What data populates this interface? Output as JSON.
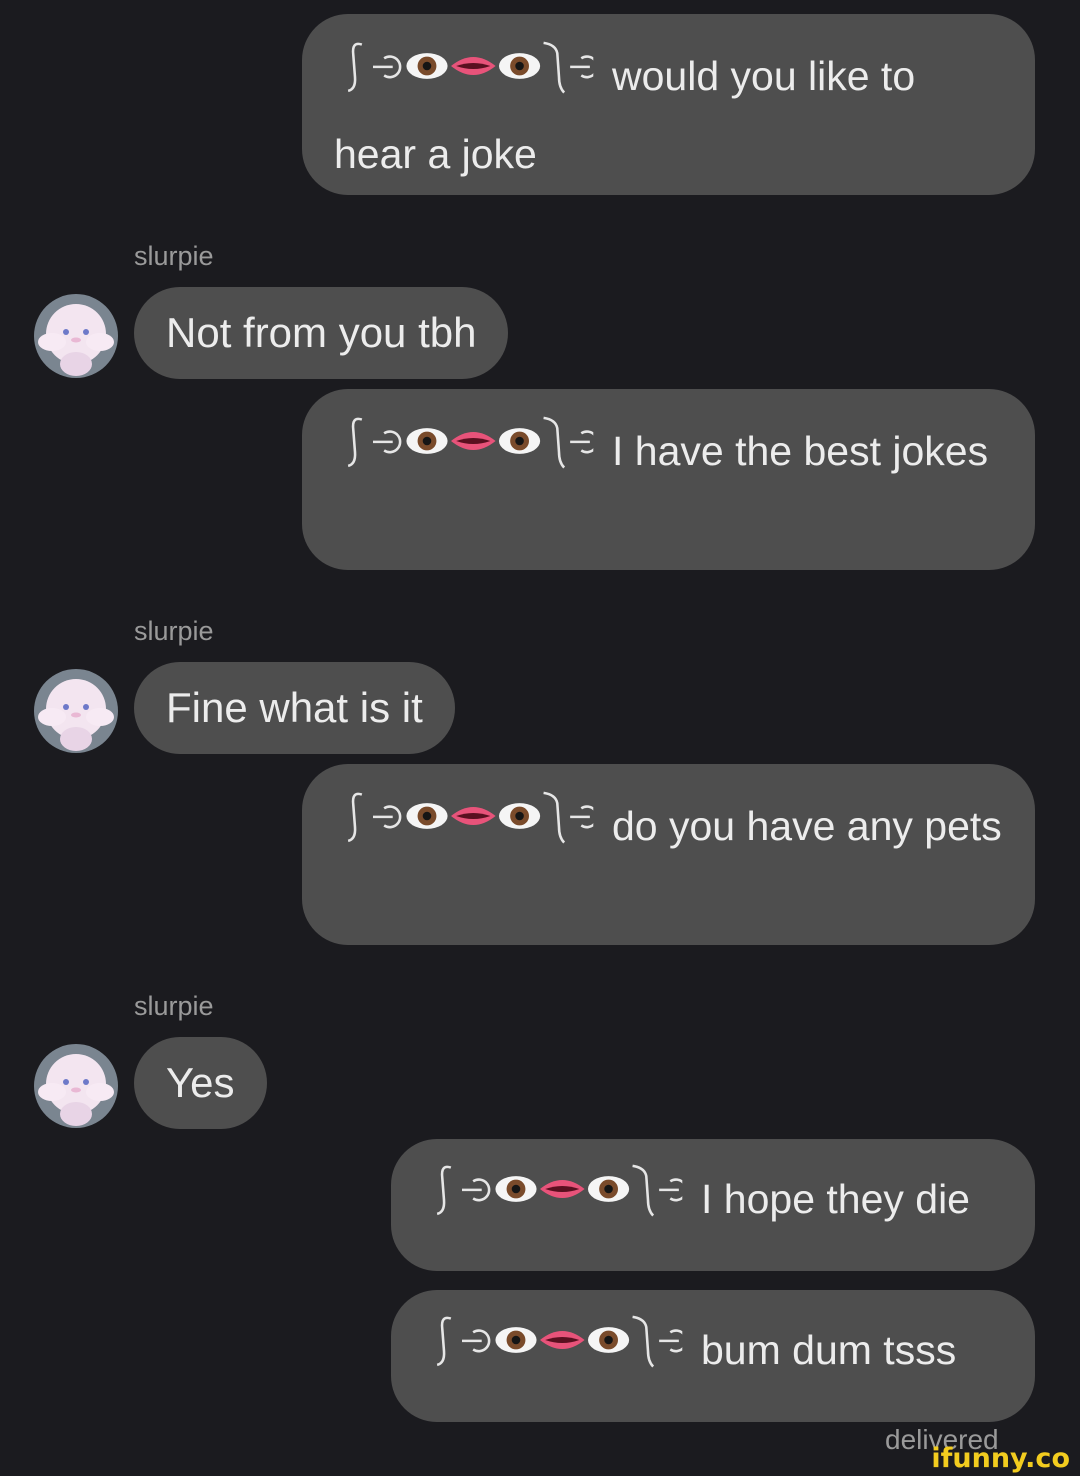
{
  "conversation": {
    "messages": [
      {
        "id": "m1",
        "from": "me",
        "text": "would you like to hear a joke"
      },
      {
        "id": "m2",
        "from": "slurpie",
        "sender": "slurpie",
        "text": "Not from you tbh"
      },
      {
        "id": "m3",
        "from": "me",
        "text": "I have the best jokes"
      },
      {
        "id": "m4",
        "from": "slurpie",
        "sender": "slurpie",
        "text": "Fine what is it"
      },
      {
        "id": "m5",
        "from": "me",
        "text": "do you have any pets"
      },
      {
        "id": "m6",
        "from": "slurpie",
        "sender": "slurpie",
        "text": "Yes"
      },
      {
        "id": "m7",
        "from": "me",
        "text": "I hope they die"
      },
      {
        "id": "m8",
        "from": "me",
        "text": "bum dum tsss"
      }
    ],
    "status": "delivered"
  },
  "watermark": "ifunny.co",
  "colors": {
    "background": "#1b1b1f",
    "bubble": "#4e4e4e",
    "text": "#ececec",
    "meta_text": "#9a9a9a",
    "watermark": "#f2cc1f"
  },
  "icons": {
    "sender_avatar": "cinnamoroll-avatar-icon",
    "face_prefix": "lenny-face-icon"
  }
}
